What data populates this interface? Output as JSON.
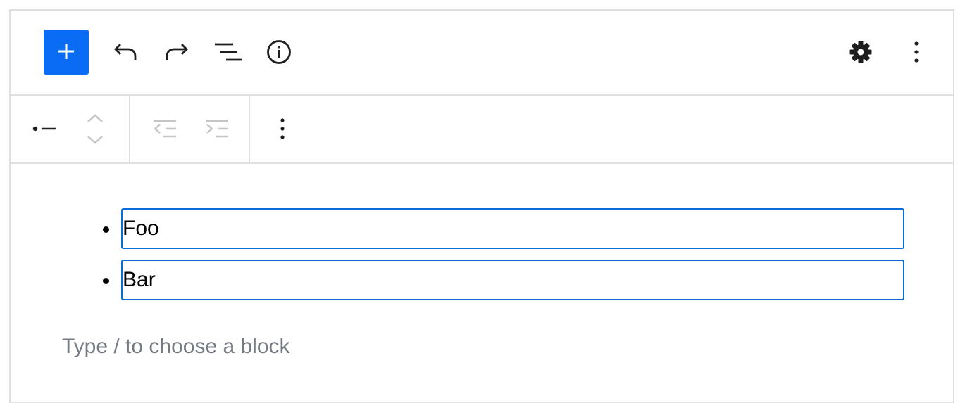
{
  "top_toolbar": {
    "inserter": {
      "icon": "plus-icon",
      "label": "Add block"
    },
    "undo": {
      "icon": "undo-icon",
      "label": "Undo"
    },
    "redo": {
      "icon": "redo-icon",
      "label": "Redo"
    },
    "list_view": {
      "icon": "list-view-icon",
      "label": "Document Overview"
    },
    "details": {
      "icon": "info-icon",
      "label": "Details"
    },
    "settings": {
      "icon": "gear-icon",
      "label": "Settings"
    },
    "options": {
      "icon": "more-vertical-icon",
      "label": "Options"
    }
  },
  "block_toolbar": {
    "block_type": {
      "icon": "list-item-icon",
      "label": "List item"
    },
    "move_up": {
      "icon": "chevron-up-icon",
      "label": "Move up"
    },
    "move_down": {
      "icon": "chevron-down-icon",
      "label": "Move down"
    },
    "outdent": {
      "icon": "outdent-icon",
      "label": "Outdent"
    },
    "indent": {
      "icon": "indent-icon",
      "label": "Indent"
    },
    "more_options": {
      "icon": "more-vertical-icon",
      "label": "Options"
    }
  },
  "list": {
    "items": [
      {
        "text": "Foo"
      },
      {
        "text": "Bar"
      }
    ]
  },
  "placeholder": "Type / to choose a block",
  "colors": {
    "accent": "#0a6cf5",
    "focus_outline": "#0a6cd4",
    "border": "#e0e0e0",
    "placeholder": "#757b82",
    "disabled_icon": "#c4c4c4"
  }
}
